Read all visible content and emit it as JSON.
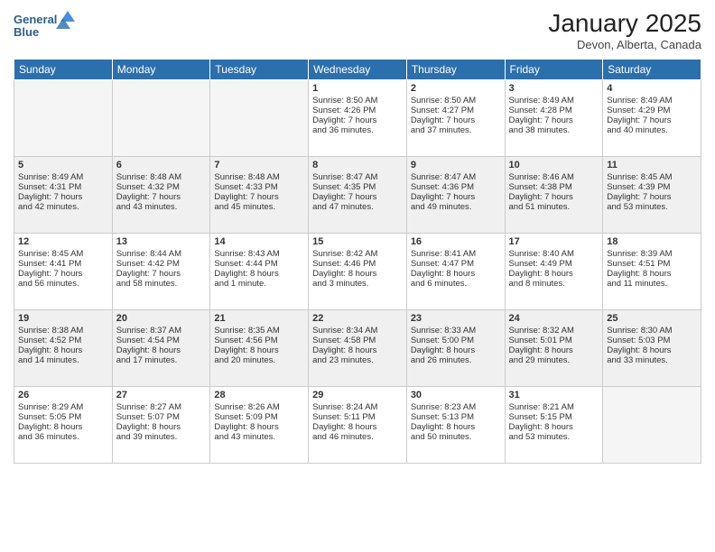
{
  "logo": {
    "line1": "General",
    "line2": "Blue"
  },
  "title": "January 2025",
  "location": "Devon, Alberta, Canada",
  "weekdays": [
    "Sunday",
    "Monday",
    "Tuesday",
    "Wednesday",
    "Thursday",
    "Friday",
    "Saturday"
  ],
  "weeks": [
    [
      {
        "day": "",
        "info": ""
      },
      {
        "day": "",
        "info": ""
      },
      {
        "day": "",
        "info": ""
      },
      {
        "day": "1",
        "info": "Sunrise: 8:50 AM\nSunset: 4:26 PM\nDaylight: 7 hours\nand 36 minutes."
      },
      {
        "day": "2",
        "info": "Sunrise: 8:50 AM\nSunset: 4:27 PM\nDaylight: 7 hours\nand 37 minutes."
      },
      {
        "day": "3",
        "info": "Sunrise: 8:49 AM\nSunset: 4:28 PM\nDaylight: 7 hours\nand 38 minutes."
      },
      {
        "day": "4",
        "info": "Sunrise: 8:49 AM\nSunset: 4:29 PM\nDaylight: 7 hours\nand 40 minutes."
      }
    ],
    [
      {
        "day": "5",
        "info": "Sunrise: 8:49 AM\nSunset: 4:31 PM\nDaylight: 7 hours\nand 42 minutes."
      },
      {
        "day": "6",
        "info": "Sunrise: 8:48 AM\nSunset: 4:32 PM\nDaylight: 7 hours\nand 43 minutes."
      },
      {
        "day": "7",
        "info": "Sunrise: 8:48 AM\nSunset: 4:33 PM\nDaylight: 7 hours\nand 45 minutes."
      },
      {
        "day": "8",
        "info": "Sunrise: 8:47 AM\nSunset: 4:35 PM\nDaylight: 7 hours\nand 47 minutes."
      },
      {
        "day": "9",
        "info": "Sunrise: 8:47 AM\nSunset: 4:36 PM\nDaylight: 7 hours\nand 49 minutes."
      },
      {
        "day": "10",
        "info": "Sunrise: 8:46 AM\nSunset: 4:38 PM\nDaylight: 7 hours\nand 51 minutes."
      },
      {
        "day": "11",
        "info": "Sunrise: 8:45 AM\nSunset: 4:39 PM\nDaylight: 7 hours\nand 53 minutes."
      }
    ],
    [
      {
        "day": "12",
        "info": "Sunrise: 8:45 AM\nSunset: 4:41 PM\nDaylight: 7 hours\nand 56 minutes."
      },
      {
        "day": "13",
        "info": "Sunrise: 8:44 AM\nSunset: 4:42 PM\nDaylight: 7 hours\nand 58 minutes."
      },
      {
        "day": "14",
        "info": "Sunrise: 8:43 AM\nSunset: 4:44 PM\nDaylight: 8 hours\nand 1 minute."
      },
      {
        "day": "15",
        "info": "Sunrise: 8:42 AM\nSunset: 4:46 PM\nDaylight: 8 hours\nand 3 minutes."
      },
      {
        "day": "16",
        "info": "Sunrise: 8:41 AM\nSunset: 4:47 PM\nDaylight: 8 hours\nand 6 minutes."
      },
      {
        "day": "17",
        "info": "Sunrise: 8:40 AM\nSunset: 4:49 PM\nDaylight: 8 hours\nand 8 minutes."
      },
      {
        "day": "18",
        "info": "Sunrise: 8:39 AM\nSunset: 4:51 PM\nDaylight: 8 hours\nand 11 minutes."
      }
    ],
    [
      {
        "day": "19",
        "info": "Sunrise: 8:38 AM\nSunset: 4:52 PM\nDaylight: 8 hours\nand 14 minutes."
      },
      {
        "day": "20",
        "info": "Sunrise: 8:37 AM\nSunset: 4:54 PM\nDaylight: 8 hours\nand 17 minutes."
      },
      {
        "day": "21",
        "info": "Sunrise: 8:35 AM\nSunset: 4:56 PM\nDaylight: 8 hours\nand 20 minutes."
      },
      {
        "day": "22",
        "info": "Sunrise: 8:34 AM\nSunset: 4:58 PM\nDaylight: 8 hours\nand 23 minutes."
      },
      {
        "day": "23",
        "info": "Sunrise: 8:33 AM\nSunset: 5:00 PM\nDaylight: 8 hours\nand 26 minutes."
      },
      {
        "day": "24",
        "info": "Sunrise: 8:32 AM\nSunset: 5:01 PM\nDaylight: 8 hours\nand 29 minutes."
      },
      {
        "day": "25",
        "info": "Sunrise: 8:30 AM\nSunset: 5:03 PM\nDaylight: 8 hours\nand 33 minutes."
      }
    ],
    [
      {
        "day": "26",
        "info": "Sunrise: 8:29 AM\nSunset: 5:05 PM\nDaylight: 8 hours\nand 36 minutes."
      },
      {
        "day": "27",
        "info": "Sunrise: 8:27 AM\nSunset: 5:07 PM\nDaylight: 8 hours\nand 39 minutes."
      },
      {
        "day": "28",
        "info": "Sunrise: 8:26 AM\nSunset: 5:09 PM\nDaylight: 8 hours\nand 43 minutes."
      },
      {
        "day": "29",
        "info": "Sunrise: 8:24 AM\nSunset: 5:11 PM\nDaylight: 8 hours\nand 46 minutes."
      },
      {
        "day": "30",
        "info": "Sunrise: 8:23 AM\nSunset: 5:13 PM\nDaylight: 8 hours\nand 50 minutes."
      },
      {
        "day": "31",
        "info": "Sunrise: 8:21 AM\nSunset: 5:15 PM\nDaylight: 8 hours\nand 53 minutes."
      },
      {
        "day": "",
        "info": ""
      }
    ]
  ]
}
